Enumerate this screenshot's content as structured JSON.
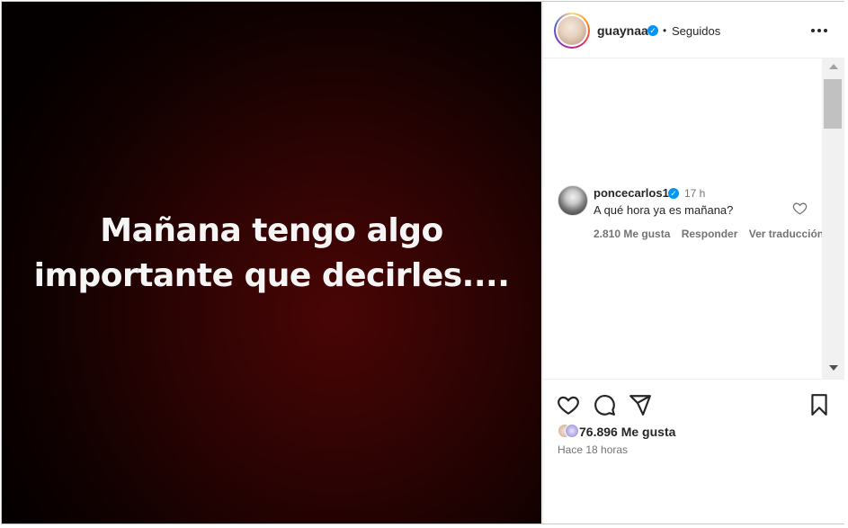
{
  "post": {
    "media_text_line1": "Mañana tengo algo",
    "media_text_line2": "importante que decirles...."
  },
  "header": {
    "username": "guaynaa",
    "separator": "•",
    "follow_status": "Seguidos",
    "more_icon": "more-horizontal-icon"
  },
  "comments": [
    {
      "username": "poncecarlos1",
      "time": "17 h",
      "text": "A qué hora ya es mañana?",
      "likes": "2.810 Me gusta",
      "reply_label": "Responder",
      "translate_label": "Ver traducción"
    }
  ],
  "actions": {
    "like_icon": "heart-icon",
    "comment_icon": "comment-icon",
    "share_icon": "send-icon",
    "save_icon": "bookmark-icon"
  },
  "likes_summary": "76.896 Me gusta",
  "posted_ago": "Hace 18 horas",
  "colors": {
    "verified": "#0095f6",
    "text_primary": "#262626",
    "text_secondary": "#737373"
  }
}
